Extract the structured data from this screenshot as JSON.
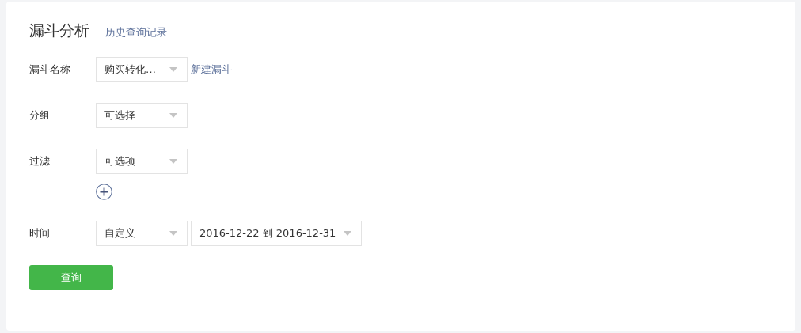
{
  "header": {
    "title": "漏斗分析",
    "history_link": "历史查询记录"
  },
  "rows": [
    {
      "label": "漏斗名称",
      "selects": [
        {
          "value": "购买转化…"
        }
      ],
      "link": "新建漏斗"
    },
    {
      "label": "分组",
      "selects": [
        {
          "value": "可选择"
        }
      ]
    },
    {
      "label": "过滤",
      "selects": [
        {
          "value": "可选项"
        }
      ],
      "add_button": true
    },
    {
      "label": "时间",
      "selects": [
        {
          "value": "自定义"
        },
        {
          "value": "2016-12-22 到 2016-12-31",
          "wide": true
        }
      ]
    }
  ],
  "submit": "查询"
}
